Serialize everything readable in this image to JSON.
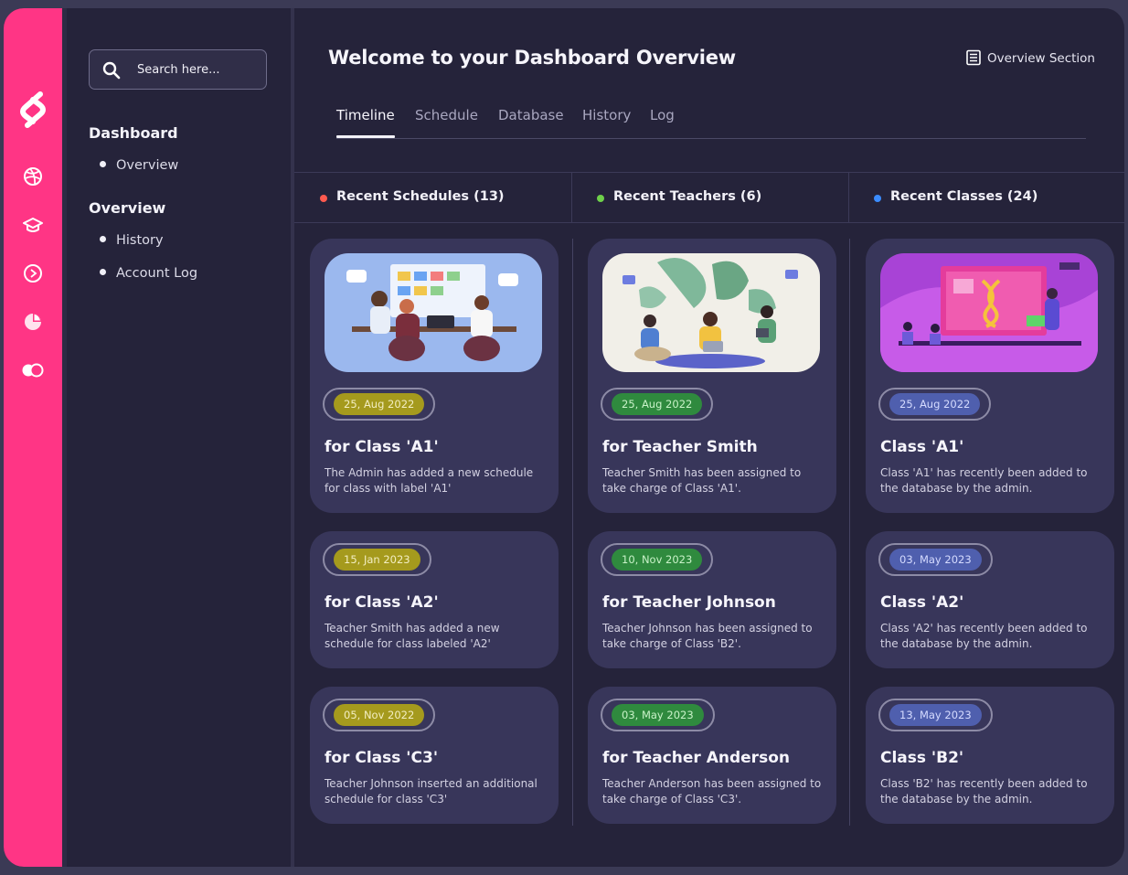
{
  "search": {
    "placeholder": "Search here..."
  },
  "sidebar": {
    "sections": [
      {
        "heading": "Dashboard",
        "items": [
          "Overview"
        ]
      },
      {
        "heading": "Overview",
        "items": [
          "History",
          "Account Log"
        ]
      }
    ]
  },
  "rail_icons": [
    "dribbble-icon",
    "graduation-cap-icon",
    "compass-icon",
    "pie-chart-icon",
    "toggle-icon"
  ],
  "header": {
    "title": "Welcome to your Dashboard Overview",
    "section_label": "Overview Section",
    "tabs": [
      "Timeline",
      "Schedule",
      "Database",
      "History",
      "Log"
    ],
    "active_tab": "Timeline"
  },
  "colors": {
    "accent": "#ff3585",
    "schedules_dot": "#ff5a4f",
    "teachers_dot": "#6ed04a",
    "classes_dot": "#3b8cff",
    "schedule_pill_fill": "#a59a1d",
    "teacher_pill_fill": "#2f8a3e",
    "class_pill_fill": "#4f5fae"
  },
  "columns": [
    {
      "heading": "Recent Schedules (13)",
      "cards": [
        {
          "date": "25, Aug 2022",
          "title": "for Class 'A1'",
          "desc": "The Admin has added a new schedule for class with label 'A1'"
        },
        {
          "date": "15, Jan 2023",
          "title": "for Class 'A2'",
          "desc": "Teacher Smith has added a new schedule for class labeled 'A2'"
        },
        {
          "date": "05, Nov 2022",
          "title": "for Class 'C3'",
          "desc": "Teacher Johnson inserted an additional schedule for class 'C3'"
        }
      ]
    },
    {
      "heading": "Recent Teachers (6)",
      "cards": [
        {
          "date": "25, Aug 2022",
          "title": "for Teacher Smith",
          "desc": "Teacher Smith has been assigned to take charge of Class 'A1'."
        },
        {
          "date": "10, Nov 2023",
          "title": "for Teacher Johnson",
          "desc": "Teacher Johnson has been assigned to take charge of Class 'B2'."
        },
        {
          "date": "03, May 2023",
          "title": "for Teacher Anderson",
          "desc": "Teacher Anderson has been assigned to take charge of Class 'C3'."
        }
      ]
    },
    {
      "heading": "Recent Classes (24)",
      "cards": [
        {
          "date": "25, Aug 2022",
          "title": "Class 'A1'",
          "desc": "Class 'A1' has recently been added to the database by the admin."
        },
        {
          "date": "03, May 2023",
          "title": "Class 'A2'",
          "desc": "Class 'A2' has recently been added to the database by the admin."
        },
        {
          "date": "13, May 2023",
          "title": "Class 'B2'",
          "desc": "Class 'B2' has recently been added to the database by the admin."
        }
      ]
    }
  ]
}
